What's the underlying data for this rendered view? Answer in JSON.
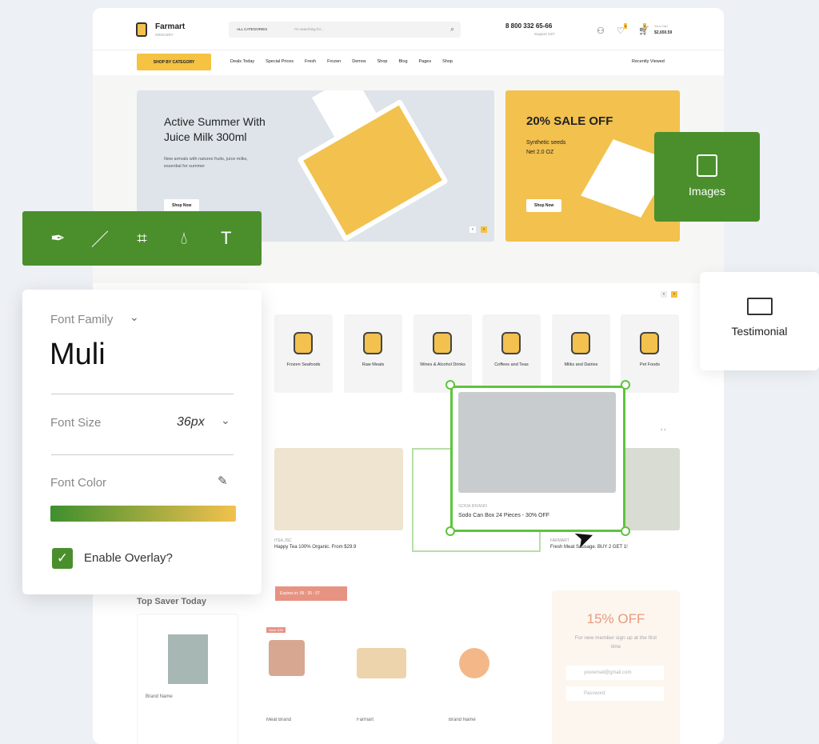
{
  "header": {
    "brand": "Farmart",
    "brand_sub": "GROCERY",
    "category_select": "ALL CATEGORIES",
    "search_placeholder": "I'm searching for...",
    "phone": "8 800 332 65-66",
    "support": "Support 24/7",
    "wishlist_count": "0",
    "cart_count": "0",
    "cart_label": "Your Cart",
    "cart_total": "$2,650.59"
  },
  "nav": {
    "shop_by_category": "SHOP BY CATEGORY",
    "items": [
      "Deals Today",
      "Special Prices",
      "Fresh",
      "Frozen",
      "Demos",
      "Shop",
      "Blog",
      "Pages",
      "Shop"
    ],
    "recently_viewed": "Recently Viewed"
  },
  "hero": {
    "title": "Active Summer With Juice Milk 300ml",
    "desc": "New arrivals with natures fruits, juice milks, essential for summer",
    "button": "Shop Now"
  },
  "promo": {
    "title": "20% SALE OFF",
    "line1": "Synthetic seeds",
    "line2": "Net 2.0 OZ",
    "button": "Shop Now"
  },
  "categories": [
    "Frozen Seafoods",
    "Raw Meats",
    "Wines & Alcohol Drinks",
    "Coffees and Teas",
    "Milks and Dairies",
    "Pet Foods"
  ],
  "products": [
    {
      "brand": "ITEA JSC",
      "name": "Happy Tea 100% Organic. From $29.9"
    },
    {
      "brand": "SODA BRAND",
      "name": "Sodo Can Box 24 Pieces - 30% OFF"
    },
    {
      "brand": "FARMART",
      "name": "Fresh Meat Sausage. BUY 2 GET 1!"
    }
  ],
  "bottom": {
    "title": "Top Saver Today",
    "countdown": "Expires in: 06 : 26 : 07",
    "save_badge": "Save 10%",
    "items": [
      "Brand Name",
      "Meat Brand",
      "Farmart",
      "Brand Name"
    ],
    "offer_title": "15% OFF",
    "offer_text": "For new member sign up at the first time",
    "email_placeholder": "youremail@gmail.com",
    "password_placeholder": "Password"
  },
  "editor": {
    "tools": [
      "pen-tool-icon",
      "brush-icon",
      "crop-icon",
      "drop-icon",
      "text-icon"
    ],
    "font_family_label": "Font Family",
    "font_family_value": "Muli",
    "font_size_label": "Font Size",
    "font_size_value": "36px",
    "font_color_label": "Font Color",
    "gradient": [
      "#3f8f2e",
      "#f2c14e"
    ],
    "overlay_label": "Enable Overlay?",
    "overlay_checked": true,
    "images_label": "Images",
    "testimonial_label": "Testimonial"
  }
}
